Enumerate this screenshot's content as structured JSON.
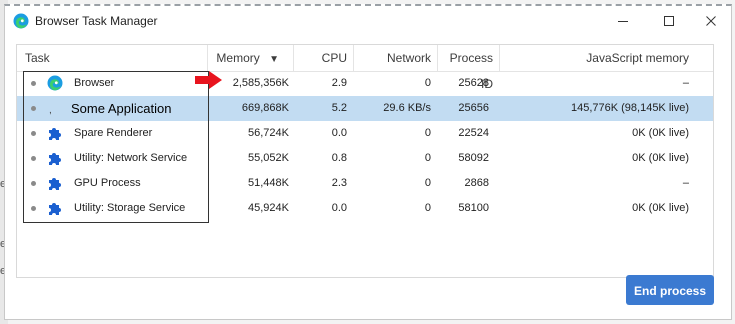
{
  "window": {
    "title": "Browser Task Manager",
    "buttons": {
      "minimize_icon": "minimize-icon",
      "maximize_icon": "maximize-icon",
      "close_icon": "close-icon"
    }
  },
  "table": {
    "headers": {
      "task": "Task",
      "memory": "Memory",
      "sort_indicator": "▼",
      "cpu": "CPU",
      "network": "Network",
      "process_id": "Process ID",
      "js_memory": "JavaScript memory"
    },
    "rows": [
      {
        "task": "Browser",
        "icon": "edge-icon",
        "memory": "2,585,356K",
        "cpu": "2.9",
        "network": "0",
        "process_id": "25628",
        "js_memory": "–",
        "selected": false
      },
      {
        "task": "",
        "icon": "tab-icon",
        "memory": "669,868K",
        "cpu": "5.2",
        "network": "29.6 KB/s",
        "process_id": "25656",
        "js_memory": "145,776K (98,145K live)",
        "selected": true
      },
      {
        "task": "Spare Renderer",
        "icon": "puzzle-icon",
        "memory": "56,724K",
        "cpu": "0.0",
        "network": "0",
        "process_id": "22524",
        "js_memory": "0K (0K live)",
        "selected": false
      },
      {
        "task": "Utility: Network Service",
        "icon": "puzzle-icon",
        "memory": "55,052K",
        "cpu": "0.8",
        "network": "0",
        "process_id": "58092",
        "js_memory": "0K (0K live)",
        "selected": false
      },
      {
        "task": "GPU Process",
        "icon": "puzzle-icon",
        "memory": "51,448K",
        "cpu": "2.3",
        "network": "0",
        "process_id": "2868",
        "js_memory": "–",
        "selected": false
      },
      {
        "task": "Utility: Storage Service",
        "icon": "puzzle-icon",
        "memory": "45,924K",
        "cpu": "0.0",
        "network": "0",
        "process_id": "58100",
        "js_memory": "0K (0K live)",
        "selected": false
      }
    ]
  },
  "annotation": {
    "overlay_label": "Some Application",
    "arrow_color": "#e8141e"
  },
  "actions": {
    "end_process": "End process"
  },
  "colors": {
    "accent": "#3b7ad1",
    "selection": "#c2dcf2"
  }
}
